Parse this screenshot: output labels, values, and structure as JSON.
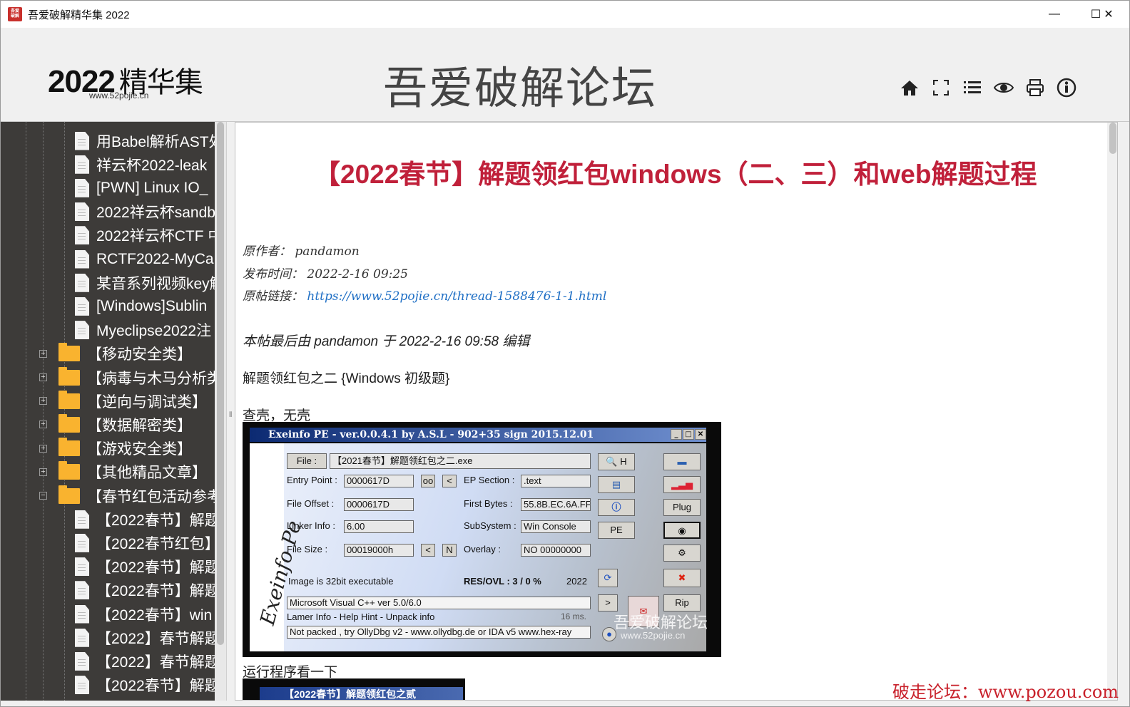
{
  "window": {
    "title": "吾爱破解精华集 2022",
    "icon_text": "吾爱破解",
    "minimize": "—",
    "maximize": "☐",
    "close": "✕"
  },
  "header": {
    "logo_year": "2022",
    "logo_word": "精华集",
    "logo_sub": "www.52pojie.cn",
    "site_title": "吾爱破解论坛",
    "tools": [
      "home-icon",
      "fullscreen-icon",
      "list-icon",
      "eye-icon",
      "print-icon",
      "info-icon"
    ]
  },
  "sidebar": {
    "items": [
      {
        "type": "file",
        "label": "用Babel解析AST处"
      },
      {
        "type": "file",
        "label": "祥云杯2022-leak"
      },
      {
        "type": "file",
        "label": "[PWN] Linux IO_"
      },
      {
        "type": "file",
        "label": "2022祥云杯sandb"
      },
      {
        "type": "file",
        "label": "2022祥云杯CTF 中"
      },
      {
        "type": "file",
        "label": "RCTF2022-MyCa"
      },
      {
        "type": "file",
        "label": "某音系列视频key解"
      },
      {
        "type": "file",
        "label": "[Windows]Sublin"
      },
      {
        "type": "file",
        "label": "Myeclipse2022注"
      },
      {
        "type": "folder",
        "label": "【移动安全类】",
        "expander": "+"
      },
      {
        "type": "folder",
        "label": "【病毒与木马分析类】",
        "expander": "+"
      },
      {
        "type": "folder",
        "label": "【逆向与调试类】",
        "expander": "+"
      },
      {
        "type": "folder",
        "label": "【数据解密类】",
        "expander": "+"
      },
      {
        "type": "folder",
        "label": "【游戏安全类】",
        "expander": "+"
      },
      {
        "type": "folder",
        "label": "【其他精品文章】",
        "expander": "+"
      },
      {
        "type": "folder-open",
        "label": "【春节红包活动参考答",
        "expander": "−"
      },
      {
        "type": "file",
        "label": "【2022春节】解题"
      },
      {
        "type": "file",
        "label": "【2022春节红包】"
      },
      {
        "type": "file",
        "label": "【2022春节】解题"
      },
      {
        "type": "file",
        "label": "【2022春节】解题"
      },
      {
        "type": "file",
        "label": "【2022春节】win"
      },
      {
        "type": "file",
        "label": "【2022】春节解题"
      },
      {
        "type": "file",
        "label": "【2022】春节解题"
      },
      {
        "type": "file",
        "label": "【2022春节】解题"
      }
    ]
  },
  "article": {
    "title": "【2022春节】解题领红包windows（二、三）和web解题过程",
    "author_label": "原作者：",
    "author": "pandamon",
    "date_label": "发布时间：",
    "date": "2022-2-16 09:25",
    "link_label": "原帖链接：",
    "link": "https://www.52pojie.cn/thread-1588476-1-1.html",
    "edit_note": "本帖最后由 pandamon 于 2022-2-16 09:58 编辑",
    "p1": "解题领红包之二 {Windows 初级题}",
    "p2": "查壳，无壳",
    "p3": "运行程序看一下"
  },
  "exeinfo": {
    "title": "Exeinfo PE - ver.0.0.4.1  by A.S.L -  902+35 sign  2015.12.01",
    "side_text": "Exeinfo Pe",
    "file_btn": "File :",
    "file_value": "【2021春节】解题领红包之二.exe",
    "entry_point_label": "Entry Point :",
    "entry_point": "0000617D",
    "oo_btn": "oo",
    "lt_btn": "<",
    "ep_section_label": "EP Section :",
    "ep_section": ".text",
    "file_offset_label": "File Offset :",
    "file_offset": "0000617D",
    "first_bytes_label": "First Bytes :",
    "first_bytes": "55.8B.EC.6A.FF",
    "linker_label": "Linker Info :",
    "linker": "6.00",
    "subsystem_label": "SubSystem :",
    "subsystem": "Win Console",
    "file_size_label": "File Size :",
    "file_size": "00019000h",
    "n_btn": "N",
    "overlay_label": "Overlay :",
    "overlay": "NO  00000000",
    "image_info": "Image is 32bit executable",
    "res_ovl": "RES/OVL : 3 / 0 %",
    "year": "2022",
    "detect": "Microsoft Visual C++ ver 5.0/6.0",
    "lamer_info": "Lamer Info - Help Hint - Unpack info",
    "ms": "16 ms.",
    "hint": "Not packed , try OllyDbg v2 - www.ollydbg.de or IDA v5 www.hex-ray",
    "plug_btn": "Plug",
    "pe_btn": "PE",
    "rip_btn": "Rip",
    "gt_btn": ">",
    "hash_btn": "H",
    "wm_title": "吾爱破解论坛",
    "wm_url": "www.52pojie.cn"
  },
  "run_image_title": "【2022春节】解题领红包之贰",
  "watermark": "破走论坛：www.pozou.com"
}
